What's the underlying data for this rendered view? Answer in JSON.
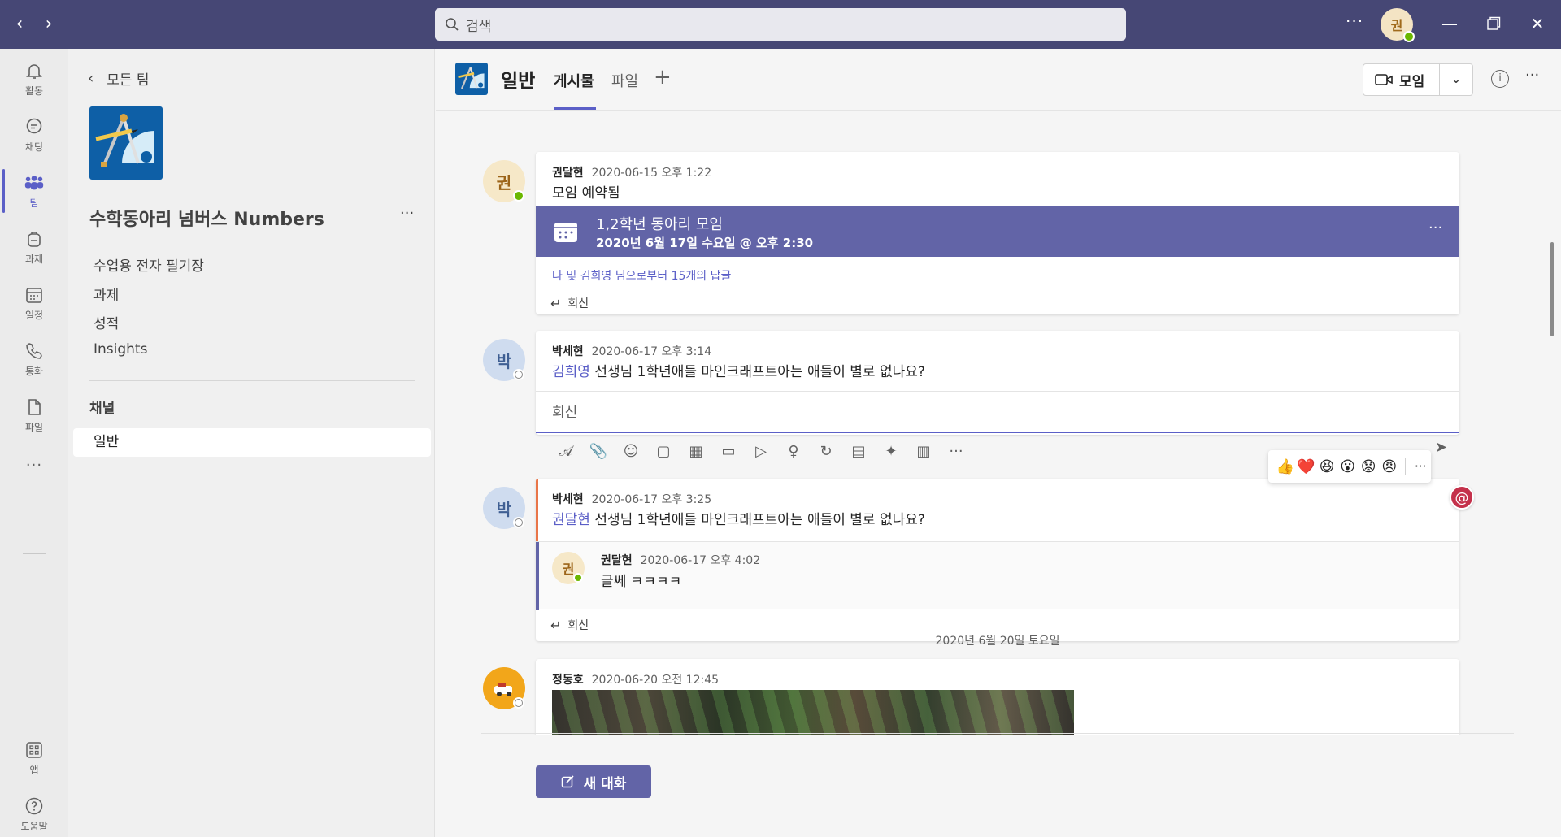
{
  "topbar": {
    "search_placeholder": "검색",
    "more": "···",
    "me_initial": "권"
  },
  "rail": [
    {
      "label": "활동",
      "icon": "bell-icon"
    },
    {
      "label": "채팅",
      "icon": "chat-icon"
    },
    {
      "label": "팀",
      "icon": "teams-icon",
      "active": true
    },
    {
      "label": "과제",
      "icon": "backpack-icon"
    },
    {
      "label": "일정",
      "icon": "calendar-icon"
    },
    {
      "label": "통화",
      "icon": "phone-icon"
    },
    {
      "label": "파일",
      "icon": "file-icon"
    }
  ],
  "rail_more": "···",
  "rail_apps": {
    "label": "앱",
    "icon": "apps-icon"
  },
  "rail_help": {
    "label": "도움말",
    "icon": "help-icon"
  },
  "team_panel": {
    "back_label": "모든 팀",
    "team_name": "수학동아리 넘버스 Numbers",
    "more": "···",
    "links": [
      "수업용 전자 필기장",
      "과제",
      "성적",
      "Insights"
    ],
    "channels_heading": "채널",
    "channel": "일반"
  },
  "channel_header": {
    "title": "일반",
    "tabs": [
      "게시물",
      "파일"
    ],
    "add": "+",
    "meet_label": "모임",
    "info": "i",
    "more": "···"
  },
  "posts": [
    {
      "author": "권달현",
      "time": "2020-06-15 오후 1:22",
      "text": "모임 예약됨",
      "avatar": "권",
      "event": {
        "title": "1,2학년 동아리 모임",
        "date": "2020년 6월 17일 수요일 @ 오후 2:30",
        "more": "···"
      },
      "replies_summary": "나 및 김희영 님으로부터 15개의 답글",
      "reply_label": "회신"
    },
    {
      "author": "박세현",
      "time": "2020-06-17 오후 3:14",
      "mention": "김희영",
      "text": " 선생님 1학년애들 마인크래프트아는 애들이 별로 없나요?",
      "avatar": "박",
      "reply_box": "회신"
    },
    {
      "author": "박세현",
      "time": "2020-06-17 오후 3:25",
      "mention": "권달현",
      "text": " 선생님 1학년애들 마인크래프트아는 애들이 별로 없나요?",
      "avatar": "박",
      "nested": {
        "author": "권달현",
        "time": "2020-06-17 오후 4:02",
        "text": "글쎄 ㅋㅋㅋㅋ",
        "avatar": "권"
      },
      "reply_label": "회신"
    },
    {
      "author": "정동호",
      "time": "2020-06-20 오전 12:45",
      "avatar_icon": "game-avatar-icon"
    }
  ],
  "date_separator": "2020년 6월 20일 토요일",
  "reactions": [
    "👍",
    "❤️",
    "😆",
    "😮",
    "😟",
    "😠"
  ],
  "reactions_more": "···",
  "at_badge": "@",
  "new_conversation": "새 대화",
  "colors": {
    "titlebar": "#464775",
    "accent": "#6264a7",
    "brand": "#5b5fc7",
    "urgent": "#e97548",
    "mention_badge": "#c4314b"
  }
}
